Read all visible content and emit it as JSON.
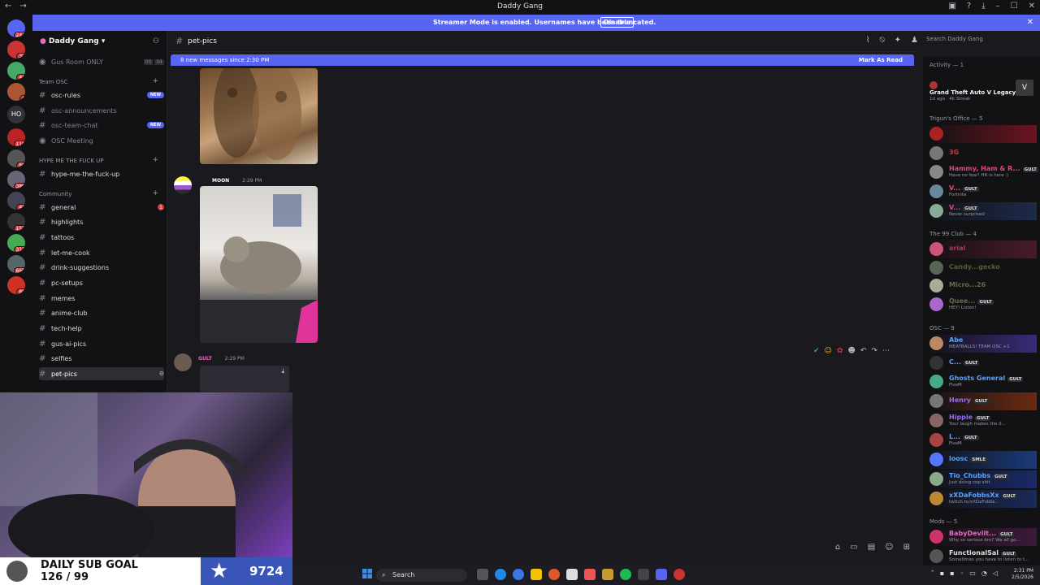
{
  "window": {
    "title": "Daddy Gang",
    "nav_back": "←",
    "nav_fwd": "→"
  },
  "banner": {
    "text": "Streamer Mode is enabled. Usernames have been truncated.",
    "button": "Disable"
  },
  "sidebar": {
    "guild_name": "Daddy Gang",
    "voice_channel": "Gus Room ONLY",
    "voice_counts": [
      "00",
      "04"
    ],
    "categories": {
      "team": "Team OSC",
      "hype": "HYPE ME THE FUCK UP",
      "community": "Community"
    },
    "team_channels": [
      {
        "label": "osc-rules",
        "badge": "NEW"
      },
      {
        "label": "osc-announcements",
        "badge": ""
      },
      {
        "label": "osc-team-chat",
        "badge": "NEW"
      },
      {
        "label": "OSC Meeting",
        "badge": ""
      }
    ],
    "hype_channels": [
      {
        "label": "hype-me-the-fuck-up"
      }
    ],
    "community_channels": [
      {
        "label": "general",
        "badge": "1"
      },
      {
        "label": "highlights"
      },
      {
        "label": "tattoos"
      },
      {
        "label": "let-me-cook"
      },
      {
        "label": "drink-suggestions"
      },
      {
        "label": "pc-setups"
      },
      {
        "label": "memes"
      },
      {
        "label": "anime-club"
      },
      {
        "label": "tech-help"
      },
      {
        "label": "gus-ai-pics"
      },
      {
        "label": "selfies"
      },
      {
        "label": "pet-pics"
      }
    ]
  },
  "server_rail": {
    "badges": [
      "241",
      "33",
      "46",
      "8",
      "HO",
      "110",
      "60",
      "380",
      "45",
      "153",
      "313",
      "669",
      "85"
    ]
  },
  "chat": {
    "channel": "pet-pics",
    "new_messages": "8 new messages since 2:30 PM",
    "mark_read": "Mark As Read",
    "msg1": {
      "user": "MOON",
      "time": "2:29 PM"
    },
    "msg2": {
      "user": "GULT",
      "time": "2:29 PM"
    }
  },
  "search": {
    "placeholder": "Search Daddy Gang"
  },
  "members": {
    "activity_header": "Activity — 1",
    "activity": {
      "name": "Grand Theft Auto V Legacy",
      "detail": "1d ago · 4k Streak"
    },
    "sections": [
      {
        "header": "Trigun's Office — 5",
        "members": [
          {
            "name": "",
            "status": "",
            "color": "#da373c"
          },
          {
            "name": "3G",
            "status": "",
            "color": "#da373c"
          },
          {
            "name": "Hammy, Ham & R...",
            "tag": "GULT",
            "status": "Have no fear! HR is here :)",
            "color": "#e04a7a"
          },
          {
            "name": "V...",
            "tag": "GULT",
            "status": "Fortnite",
            "color": "#e04a7a"
          },
          {
            "name": "V...",
            "tag": "GULT",
            "status": "Never surprised",
            "color": "#e04a7a"
          }
        ]
      },
      {
        "header": "The 99 Club — 4",
        "members": [
          {
            "name": "arial",
            "status": "",
            "color": "#a83a5a"
          },
          {
            "name": "Candy...gecko",
            "status": "",
            "color": "#5a5a3a"
          },
          {
            "name": "Micro...26",
            "status": "",
            "color": "#6a6a4a"
          },
          {
            "name": "Quee...",
            "tag": "GULT",
            "status": "HEY! Listen!",
            "color": "#6a6a4a"
          }
        ]
      },
      {
        "header": "OSC — 9",
        "members": [
          {
            "name": "Abe",
            "status": "MEATBALLS! TEAM OSC +1",
            "color": "#57a3ff"
          },
          {
            "name": "C...",
            "tag": "GULT",
            "status": "",
            "color": "#57a3ff"
          },
          {
            "name": "Ghosts General",
            "tag": "GULT",
            "status": "FiveM",
            "color": "#57a3ff"
          },
          {
            "name": "Henry",
            "tag": "GULT",
            "status": "",
            "color": "#9a6bff"
          },
          {
            "name": "Hippie",
            "tag": "GULT",
            "status": "Your laugh makes the d...",
            "color": "#9a6bff"
          },
          {
            "name": "L...",
            "tag": "GULT",
            "status": "FiveM",
            "color": "#57a3ff"
          },
          {
            "name": "loosc",
            "tag": "SMLE",
            "status": "",
            "color": "#57a3ff"
          },
          {
            "name": "Tio_Chubbs",
            "tag": "GULT",
            "status": "Just doing cop shit",
            "color": "#57a3ff"
          },
          {
            "name": "xXDaFobbsXx",
            "tag": "GULT",
            "status": "twitch.tv/xXDaFobbs...",
            "color": "#57a3ff"
          }
        ]
      },
      {
        "header": "Mods — 5",
        "members": [
          {
            "name": "BabyDevilt...",
            "tag": "GULT",
            "status": "Why so serious bro? We all go...",
            "color": "#e86ac0"
          },
          {
            "name": "FunctionalSal",
            "tag": "GULT",
            "status": "Sometimes you have to listen to t...",
            "color": "#dbdee1"
          }
        ]
      }
    ]
  },
  "sub_goal": {
    "label": "DAILY SUB GOAL",
    "progress_text": "126 / 99",
    "count": "9724"
  },
  "taskbar": {
    "search": "Search",
    "time": "2:31 PM",
    "date": "2/5/2026"
  }
}
